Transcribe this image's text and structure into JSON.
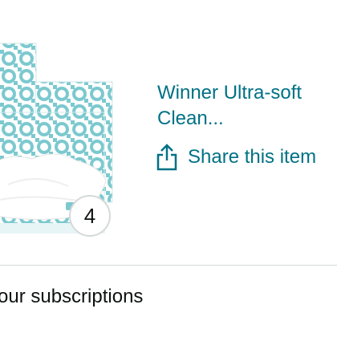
{
  "product": {
    "title_line1": "Winner Ultra-soft",
    "title_line2": "Clean...",
    "quantity_badge": "4",
    "image_alt": "tissue box product image"
  },
  "share": {
    "label": "Share this item",
    "icon": "share-icon"
  },
  "section": {
    "label": "our subscriptions"
  },
  "colors": {
    "link": "#007185",
    "text": "#0f1111",
    "divider": "#d5d9d9",
    "pattern": "#7cc9cf"
  }
}
